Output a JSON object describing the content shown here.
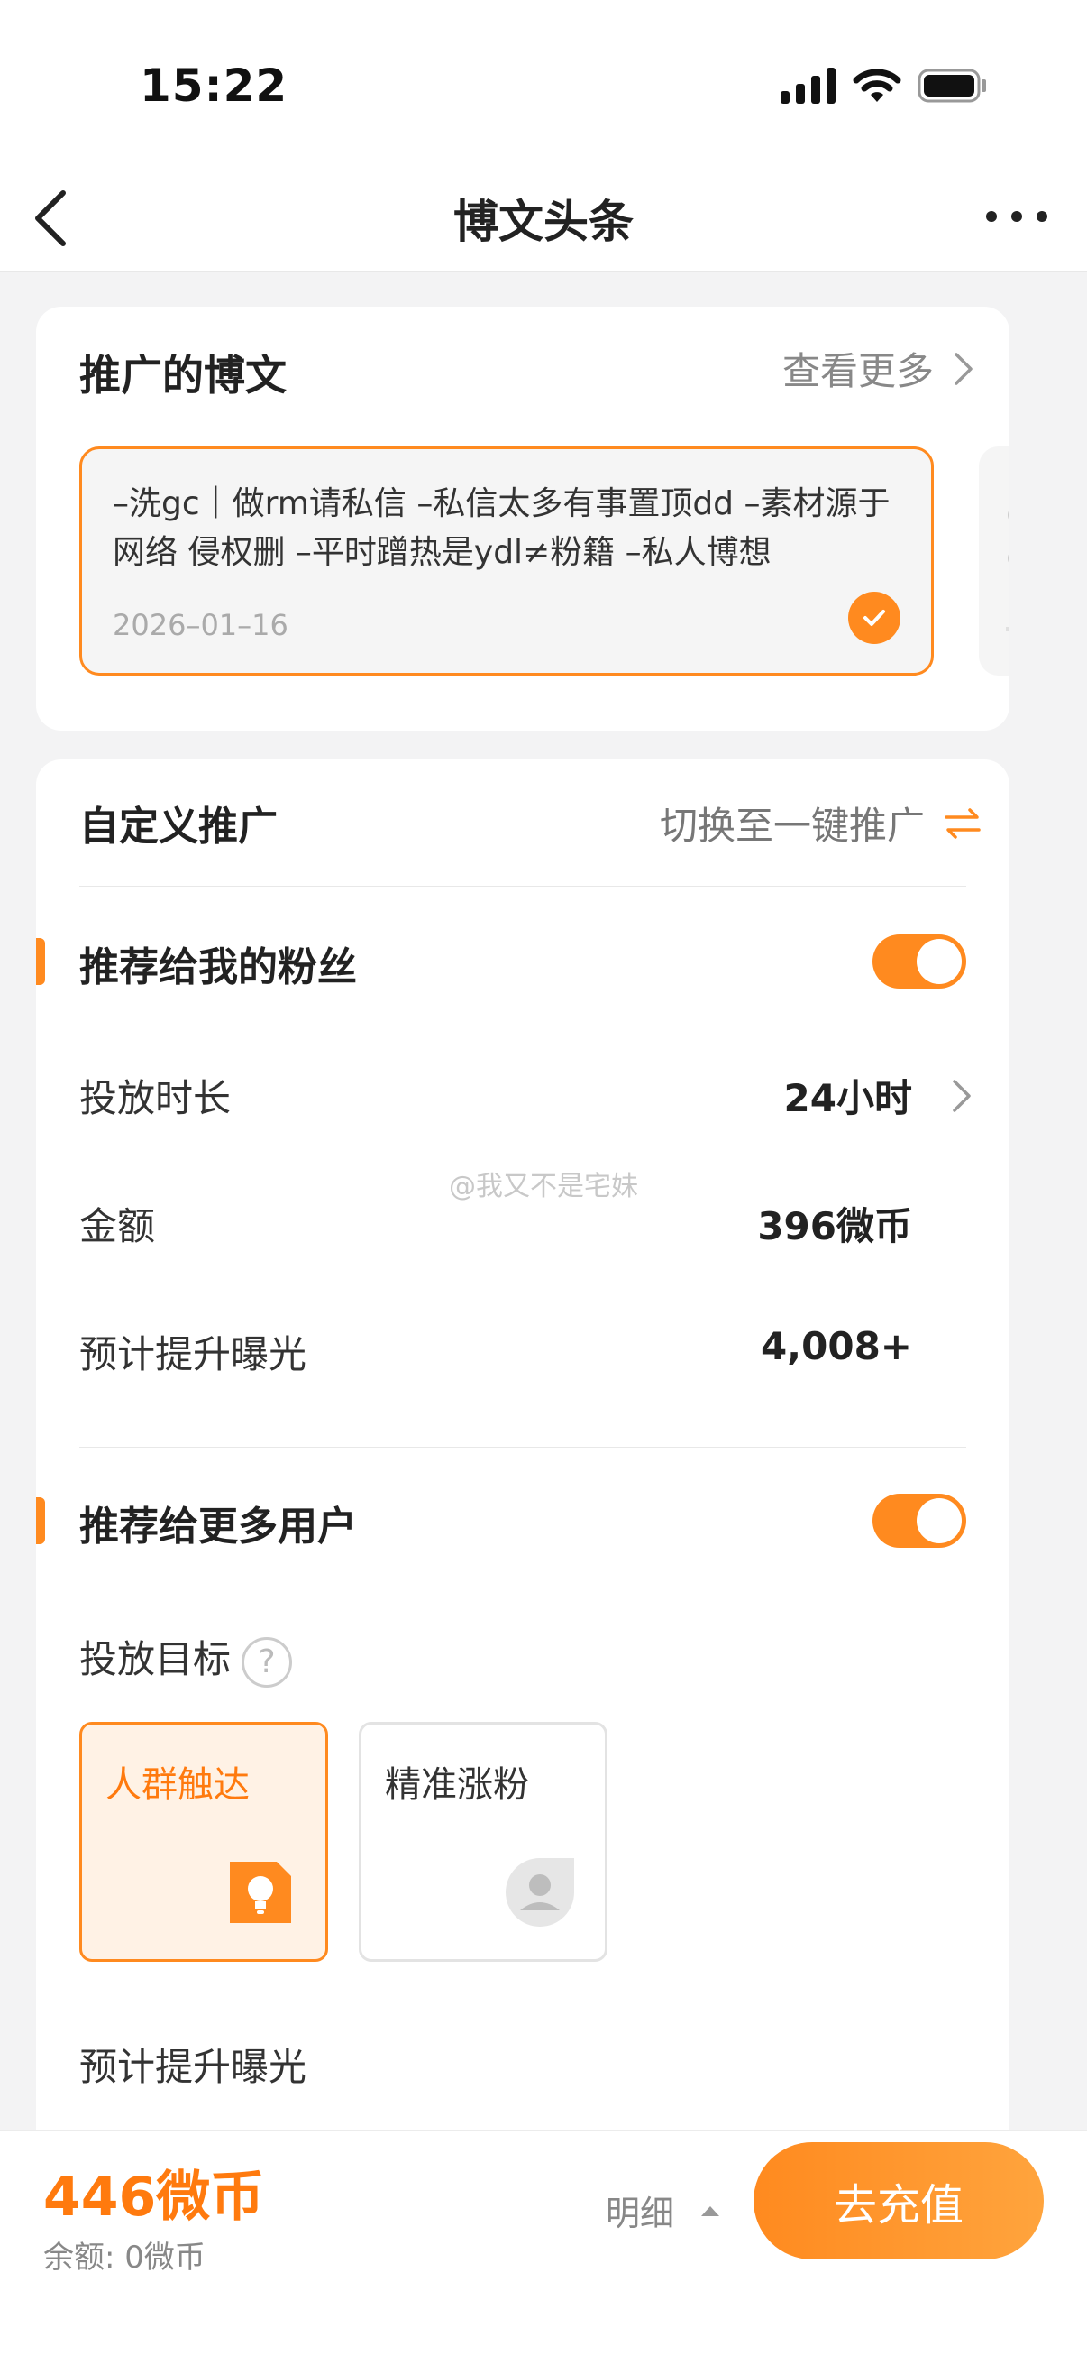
{
  "status_bar": {
    "time": "15:22"
  },
  "nav": {
    "title": "博文头条"
  },
  "promoted_post": {
    "header": "推广的博文",
    "see_more": "查看更多",
    "text": "–洗gc｜做rm请私信 –私信太多有事置顶dd –素材源于网络 侵权删 –平时蹭热是ydl≠粉籍 –私人博想",
    "date": "2026–01–16"
  },
  "custom_promo": {
    "title": "自定义推广",
    "switch_label": "切换至一键推广"
  },
  "fans_section": {
    "title": "推荐给我的粉丝",
    "duration_label": "投放时长",
    "duration_value": "24小时",
    "amount_label": "金额",
    "amount_value": "396微币",
    "exposure_label": "预计提升曝光",
    "exposure_value": "4,008+"
  },
  "watermark": "@我又不是宅妹",
  "more_users_section": {
    "title": "推荐给更多用户",
    "goal_label": "投放目标",
    "goals": [
      {
        "label": "人群触达",
        "icon": "lightbulb-icon",
        "selected": true
      },
      {
        "label": "精准涨粉",
        "icon": "person-icon",
        "selected": false
      }
    ],
    "exposure_label": "预计提升曝光"
  },
  "bottom_bar": {
    "price": "446微币",
    "balance": "余额: 0微币",
    "detail_label": "明细",
    "recharge_label": "去充值"
  },
  "colors": {
    "accent": "#ff8a1f",
    "background": "#f3f3f4"
  }
}
